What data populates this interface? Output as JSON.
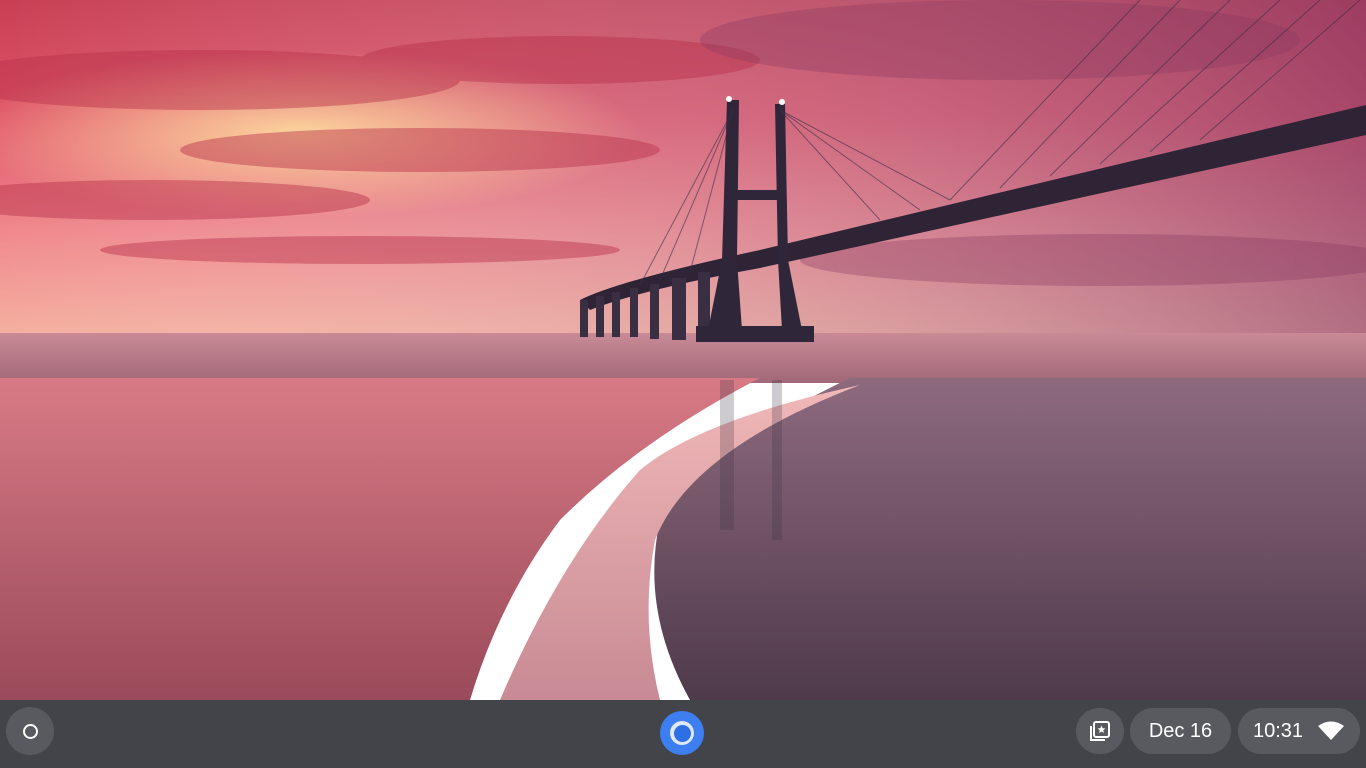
{
  "desktop": {
    "wallpaper": "sunset-over-cable-stayed-bridge-and-tidal-flats"
  },
  "shelf": {
    "launcher": {
      "icon": "launcher-icon"
    },
    "pinned_apps": [
      {
        "icon": "chrome-icon",
        "active": true
      }
    ],
    "tray": {
      "holding_space_icon": "holding-space-icon",
      "date": "Dec 16",
      "time": "10:31",
      "network_icon": "wifi-icon"
    }
  },
  "colors": {
    "shelf_bg": "#2a2c30",
    "pill_bg": "#4a4b50",
    "chrome_blue": "#3d7ef0",
    "text": "#ffffff"
  }
}
